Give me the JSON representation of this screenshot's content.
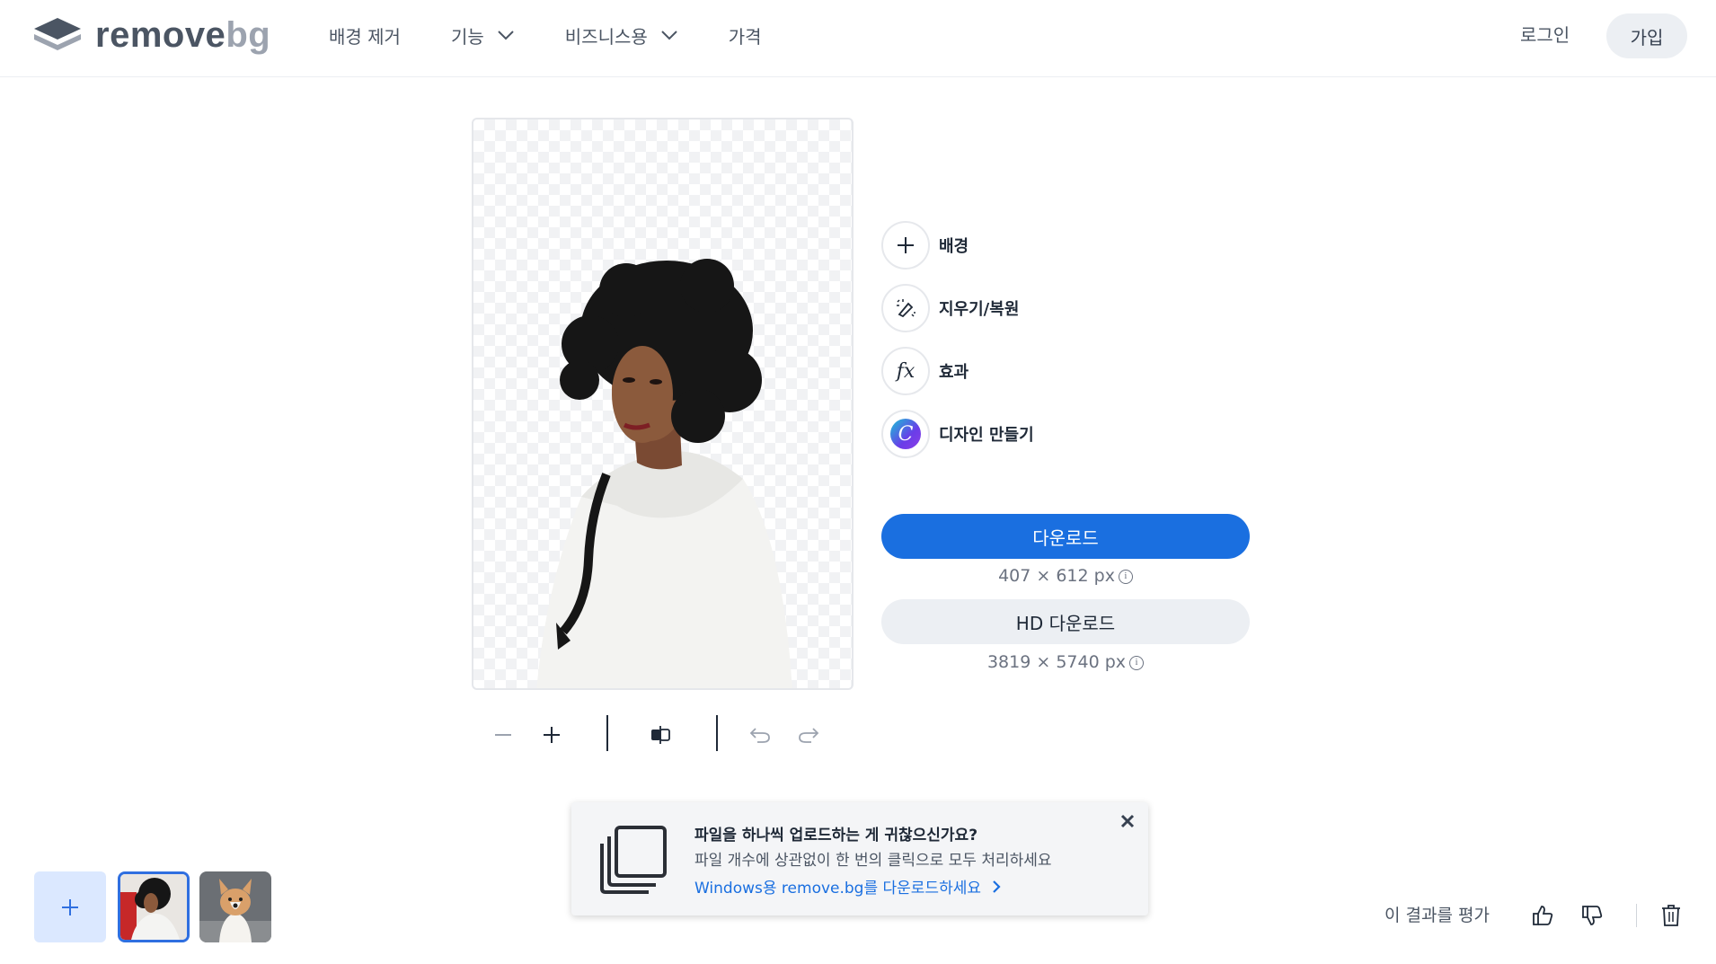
{
  "header": {
    "logo_main": "remove",
    "logo_accent": "bg",
    "nav": [
      {
        "label": "배경 제거",
        "has_dropdown": false
      },
      {
        "label": "기능",
        "has_dropdown": true
      },
      {
        "label": "비즈니스용",
        "has_dropdown": true
      },
      {
        "label": "가격",
        "has_dropdown": false
      }
    ],
    "login_label": "로그인",
    "signup_label": "가입"
  },
  "editor": {
    "tools": [
      {
        "label": "배경",
        "icon": "plus-icon"
      },
      {
        "label": "지우기/복원",
        "icon": "magic-brush-icon"
      },
      {
        "label": "효과",
        "icon": "fx-icon",
        "icon_text": "fx"
      },
      {
        "label": "디자인 만들기",
        "icon": "canva-icon",
        "icon_text": "C"
      }
    ],
    "download_label": "다운로드",
    "download_size": "407 × 612 px",
    "hd_download_label": "HD 다운로드",
    "hd_download_size": "3819 × 5740 px",
    "info_glyph": "i"
  },
  "zoom_controls": {
    "icons": [
      "zoom-out-icon",
      "zoom-in-icon",
      "compare-icon",
      "undo-icon",
      "redo-icon"
    ]
  },
  "notice": {
    "title": "파일을 하나씩 업로드하는 게 귀찮으신가요?",
    "subtitle": "파일 개수에 상관없이 한 번의 클릭으로 모두 처리하세요",
    "link": "Windows용 remove.bg를 다운로드하세요"
  },
  "rating": {
    "label": "이 결과를 평가"
  },
  "colors": {
    "primary": "#1a6fe0",
    "text": "#1f2937",
    "muted": "#6b7280",
    "thumb_selected": "#2f6fe0",
    "add_tile": "#dbe8ff"
  }
}
